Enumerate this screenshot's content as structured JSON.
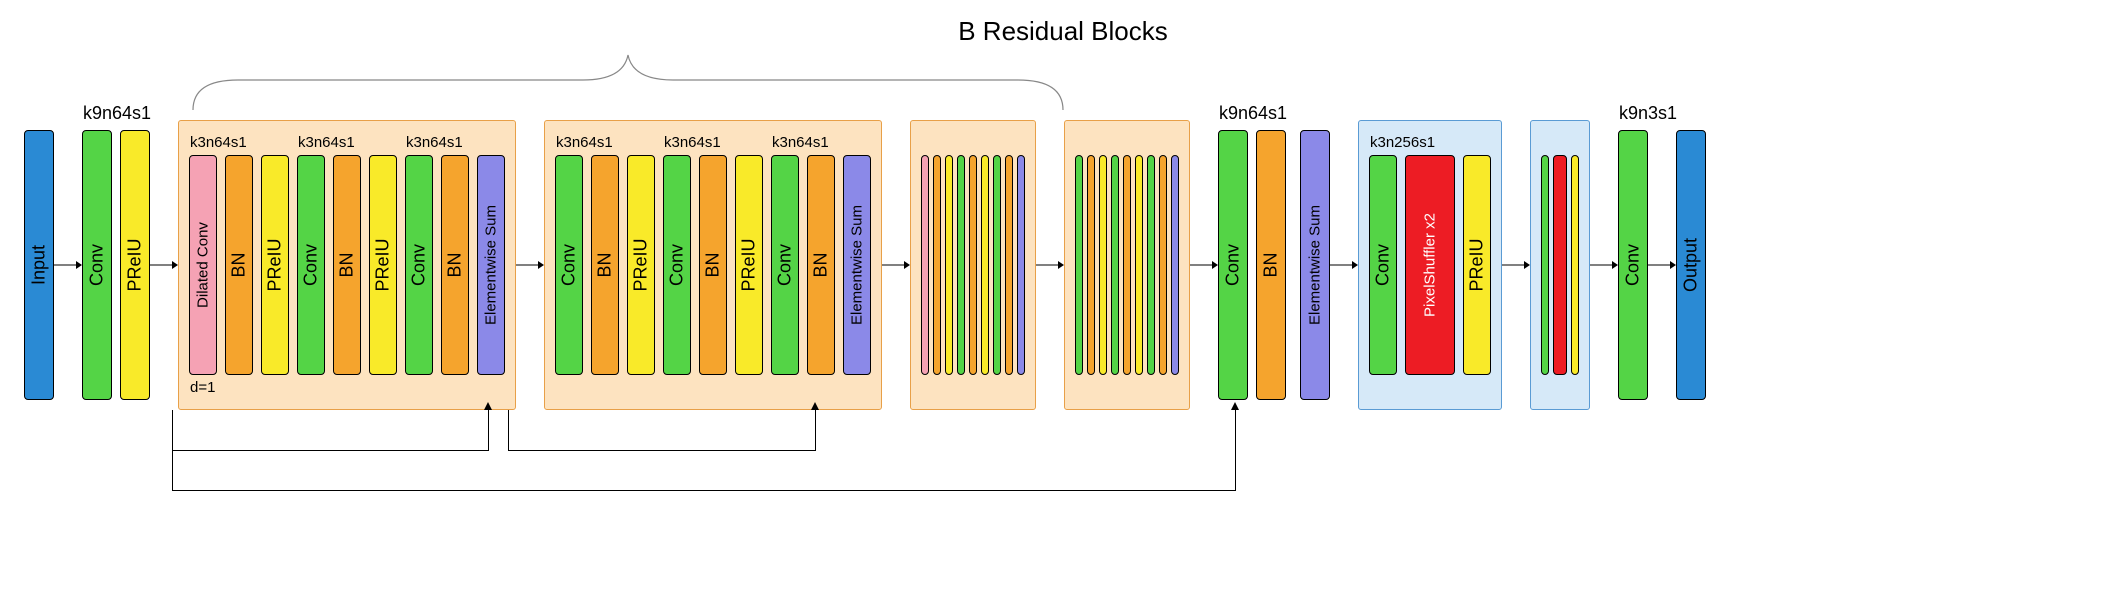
{
  "title": "B Residual Blocks",
  "labels": {
    "k9n64s1": "k9n64s1",
    "k3n64s1": "k3n64s1",
    "k3n256s1": "k3n256s1",
    "k9n3s1": "k9n3s1",
    "d1": "d=1"
  },
  "layers": {
    "input": "Input",
    "output": "Output",
    "conv": "Conv",
    "dilated_conv": "Dilated Conv",
    "prelu": "PReIU",
    "bn": "BN",
    "esum": "Elementwise Sum",
    "pixshuf": "PixelShuffler x2"
  },
  "architecture": {
    "pre": [
      {
        "type": "Input",
        "color": "blue"
      },
      {
        "type": "Conv",
        "color": "green",
        "label": "k9n64s1"
      },
      {
        "type": "PReIU",
        "color": "yellow"
      }
    ],
    "residual_blocks": {
      "count_label": "B",
      "block1": {
        "layers": [
          "Dilated Conv",
          "BN",
          "PReIU",
          "Conv",
          "BN",
          "PReIU",
          "Conv",
          "BN",
          "Elementwise Sum"
        ],
        "annotations": {
          "dilation": "d=1",
          "conv_label": "k3n64s1"
        }
      },
      "block2": {
        "layers": [
          "Conv",
          "BN",
          "PReIU",
          "Conv",
          "BN",
          "PReIU",
          "Conv",
          "BN",
          "Elementwise Sum"
        ],
        "annotations": {
          "conv_label": "k3n64s1"
        }
      },
      "collapsed_blocks": 2
    },
    "post_residual": [
      {
        "type": "Conv",
        "color": "green",
        "label": "k9n64s1"
      },
      {
        "type": "BN",
        "color": "orange"
      },
      {
        "type": "Elementwise Sum",
        "color": "purple"
      }
    ],
    "upsample_block1": {
      "label": "k3n256s1",
      "layers": [
        "Conv",
        "PixelShuffler x2",
        "PReIU"
      ]
    },
    "upsample_block2": {
      "collapsed": true,
      "layers": [
        "Conv",
        "PixelShuffler x2",
        "PReIU"
      ]
    },
    "tail": [
      {
        "type": "Conv",
        "color": "green",
        "label": "k9n3s1"
      },
      {
        "type": "Output",
        "color": "blue"
      }
    ],
    "skip_connections": [
      {
        "from": "after pre-PReIU",
        "to": "block1 Elementwise Sum"
      },
      {
        "from": "after block1",
        "to": "block2 Elementwise Sum"
      },
      {
        "from": "after pre-PReIU",
        "to": "post Elementwise Sum (global)"
      }
    ]
  }
}
